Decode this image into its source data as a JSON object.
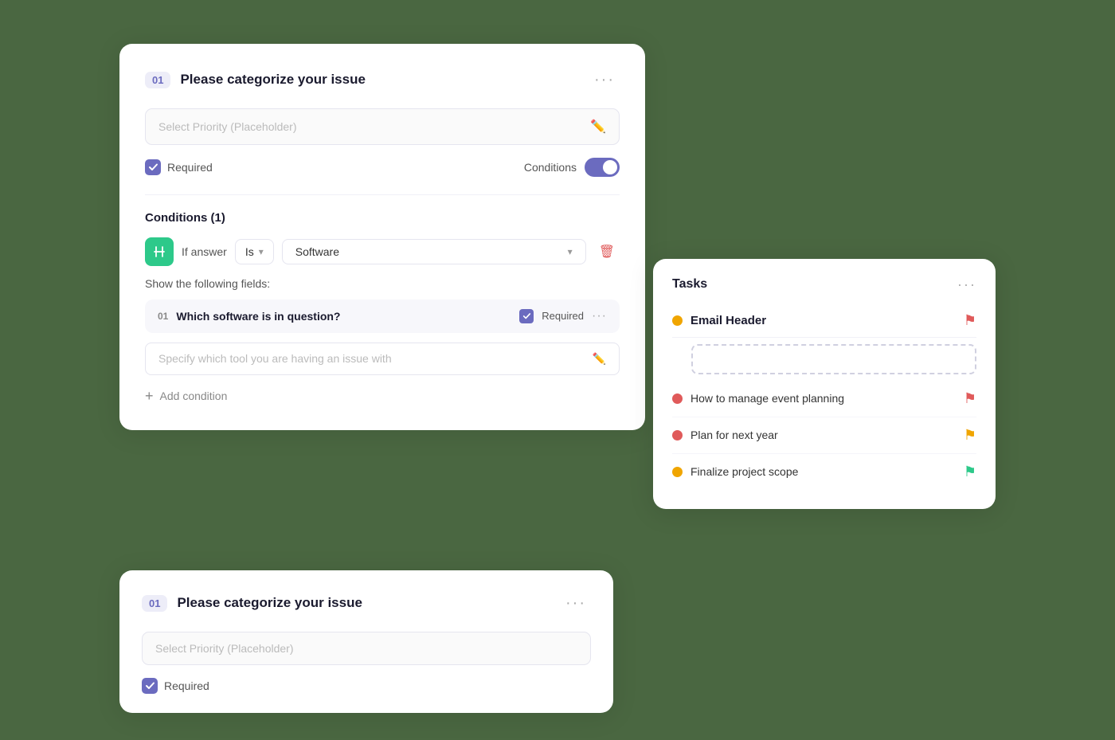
{
  "main_card": {
    "step": "01",
    "title": "Please categorize your issue",
    "select_placeholder": "Select Priority (Placeholder)",
    "required_label": "Required",
    "conditions_label": "Conditions",
    "toggle_on": true,
    "conditions_section_title": "Conditions (1)",
    "if_answer_label": "If answer",
    "is_option": "Is",
    "software_option": "Software",
    "show_fields_label": "Show the following fields:",
    "sub_field": {
      "step": "01",
      "title": "Which software is in question?",
      "required_label": "Required",
      "placeholder": "Specify which tool you are having an issue with"
    },
    "add_condition_label": "Add condition",
    "dots_label": "···"
  },
  "second_card": {
    "step": "01",
    "title": "Please categorize your issue",
    "select_placeholder": "Select Priority (Placeholder)",
    "required_label": "Required",
    "dots_label": "···"
  },
  "tasks_card": {
    "title": "Tasks",
    "dots_label": "···",
    "email_header_label": "Email Header",
    "tasks": [
      {
        "label": "How to manage event planning",
        "dot_color": "red",
        "flag_color": "red"
      },
      {
        "label": "Plan for next year",
        "dot_color": "red",
        "flag_color": "yellow"
      },
      {
        "label": "Finalize project scope",
        "dot_color": "yellow",
        "flag_color": "green"
      }
    ]
  }
}
